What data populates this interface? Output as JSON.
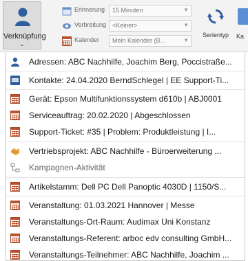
{
  "ribbon": {
    "verknuepfung_label": "Verknüpfung",
    "verknuepfung_chevron": "⌄",
    "fields": [
      {
        "label": "Erinnerung",
        "value": "15 Minuten",
        "icon": "reminder-icon"
      },
      {
        "label": "Verbreitung",
        "value": "<Keiner>",
        "icon": "visibility-icon"
      },
      {
        "label": "Kalender",
        "value": "Mein Kalender (B...",
        "icon": "calendar-icon"
      }
    ],
    "serientyp_label": "Serientyp",
    "ka_label": "Ka"
  },
  "menu": {
    "items": [
      {
        "label": "Adressen: ABC Nachhilfe, Joachim Berg, Poccistraße...",
        "icon": "person-icon"
      },
      {
        "label": "Kontakte: 24.04.2020 BerndSchlegel | EE Support-Ti...",
        "icon": "contact-card-icon"
      },
      {
        "label": "Gerät: Epson Multifunktionssystem d610b | ABJ0001",
        "icon": "calendar-grid-icon"
      },
      {
        "label": "Serviceauftrag: 20.02.2020  | Abgeschlossen",
        "icon": "calendar-grid-icon"
      },
      {
        "label": "Support-Ticket: #35 | Problem: Produktleistung | I...",
        "icon": "calendar-grid-icon"
      },
      {
        "label": "Vertriebsprojekt: ABC Nachhilfe - Büroerweiterung ...",
        "icon": "handshake-icon"
      },
      {
        "label": "Kampagnen-Aktivität",
        "icon": "campaign-icon"
      },
      {
        "label": "Artikelstamm: Dell PC Dell Panoptic 4030D | 1150/S...",
        "icon": "calendar-grid-icon"
      },
      {
        "label": "Veranstaltung: 01.03.2021 Hannover | Messe",
        "icon": "calendar-grid-icon"
      },
      {
        "label": "Veranstaltungs-Ort-Raum: Audimax Uni Konstanz",
        "icon": "calendar-grid-icon"
      },
      {
        "label": "Veranstaltungs-Referent: arboc edv consulting GmbH...",
        "icon": "calendar-grid-icon"
      },
      {
        "label": "Veranstaltungs-Teilnehmer: ABC Nachhilfe, Joachim ...",
        "icon": "calendar-grid-icon"
      }
    ]
  },
  "colors": {
    "accent_blue": "#2f5f9e",
    "calendar_red": "#c0502b",
    "handshake_yellow": "#e8a33c"
  }
}
